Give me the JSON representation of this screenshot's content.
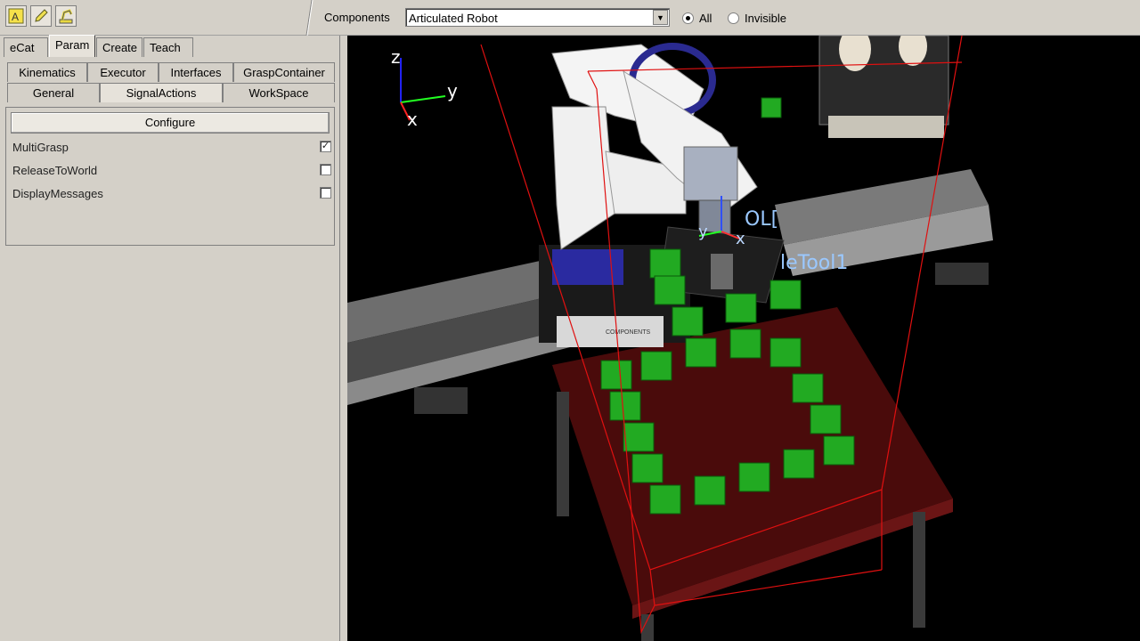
{
  "toolbar": {
    "buttons": [
      {
        "icon": "text-a-icon"
      },
      {
        "icon": "pencil-icon"
      },
      {
        "icon": "robot-arm-icon"
      }
    ],
    "components_label": "Components",
    "components_value": "Articulated Robot",
    "radio_all": "All",
    "radio_invisible": "Invisible",
    "radio_selected": "All"
  },
  "left_panel": {
    "main_tabs": [
      "eCat",
      "Param",
      "Create",
      "Teach"
    ],
    "active_main_tab": "Param",
    "subtabs_row1": [
      "Kinematics",
      "Executor",
      "Interfaces",
      "GraspContainer"
    ],
    "subtabs_row2": [
      "General",
      "SignalActions",
      "WorkSpace"
    ],
    "active_subtab": "SignalActions",
    "configure_label": "Configure",
    "properties": [
      {
        "label": "MultiGrasp",
        "checked": true
      },
      {
        "label": "ReleaseToWorld",
        "checked": false
      },
      {
        "label": "DisplayMessages",
        "checked": false
      }
    ]
  },
  "viewport": {
    "axis_labels": {
      "z": "z",
      "y": "y",
      "x": "x"
    },
    "tool_label_1": "OL[",
    "tool_label_2": "leTool1",
    "frame_labels": {
      "y": "y",
      "x": "x"
    },
    "logo_text": "COMPONENTS"
  }
}
